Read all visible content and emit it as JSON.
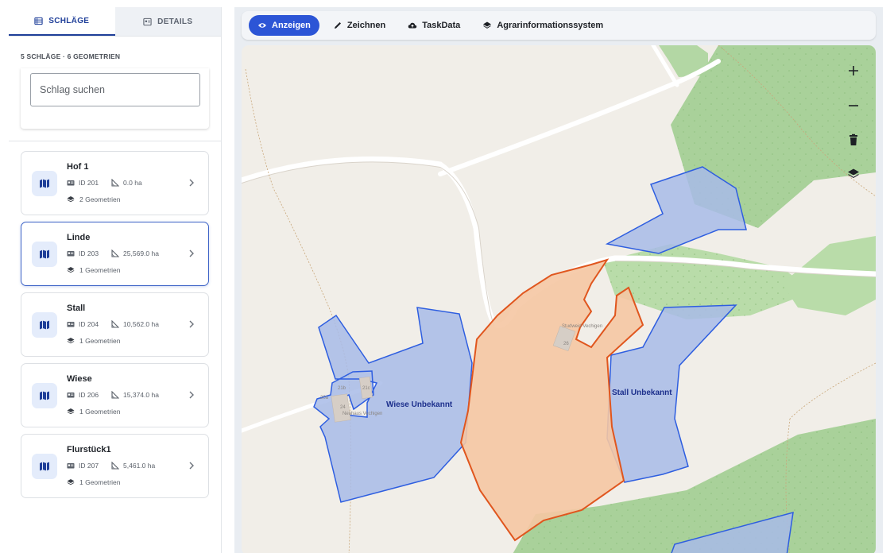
{
  "sidebar": {
    "tabs": [
      {
        "label": "SCHLÄGE",
        "icon": "list-icon",
        "active": true
      },
      {
        "label": "DETAILS",
        "icon": "details-icon",
        "active": false
      }
    ],
    "summary": "5 SCHLÄGE · 6 GEOMETRIEN",
    "search": {
      "placeholder": "Schlag suchen",
      "value": ""
    },
    "fields": [
      {
        "name": "Hof 1",
        "id": "ID 201",
        "area": "0.0 ha",
        "geometries": "2 Geometrien",
        "selected": false
      },
      {
        "name": "Linde",
        "id": "ID 203",
        "area": "25,569.0 ha",
        "geometries": "1 Geometrien",
        "selected": true
      },
      {
        "name": "Stall",
        "id": "ID 204",
        "area": "10,562.0 ha",
        "geometries": "1 Geometrien",
        "selected": false
      },
      {
        "name": "Wiese",
        "id": "ID 206",
        "area": "15,374.0 ha",
        "geometries": "1 Geometrien",
        "selected": false
      },
      {
        "name": "Flurstück1",
        "id": "ID 207",
        "area": "5,461.0 ha",
        "geometries": "1 Geometrien",
        "selected": false
      }
    ]
  },
  "toolbar": {
    "buttons": [
      {
        "label": "Anzeigen",
        "icon": "eye-icon",
        "active": true
      },
      {
        "label": "Zeichnen",
        "icon": "pencil-icon",
        "active": false
      },
      {
        "label": "TaskData",
        "icon": "cloud-upload-icon",
        "active": false
      },
      {
        "label": "Agrarinformationssystem",
        "icon": "layers-icon",
        "active": false
      }
    ]
  },
  "map": {
    "labels": {
      "wiese": "Wiese Unbekannt",
      "stall": "Stall Unbekannt",
      "studweid": "Studweid Vechigen",
      "neuhaus": "Neuhaus Vechigen",
      "n26": "26",
      "n24": "24",
      "n21b": "21b",
      "n21c": "21c",
      "n20a": "20a"
    },
    "colors": {
      "background": "#f1eee8",
      "forest": "#a9d19a",
      "meadow": "#c7e3b4",
      "field_blue_fill": "#a8bbe8",
      "field_blue_stroke": "#2e5ee0",
      "field_orange_fill": "#f5c6a3",
      "field_orange_stroke": "#e0561e",
      "accent": "#2c55d6"
    }
  }
}
